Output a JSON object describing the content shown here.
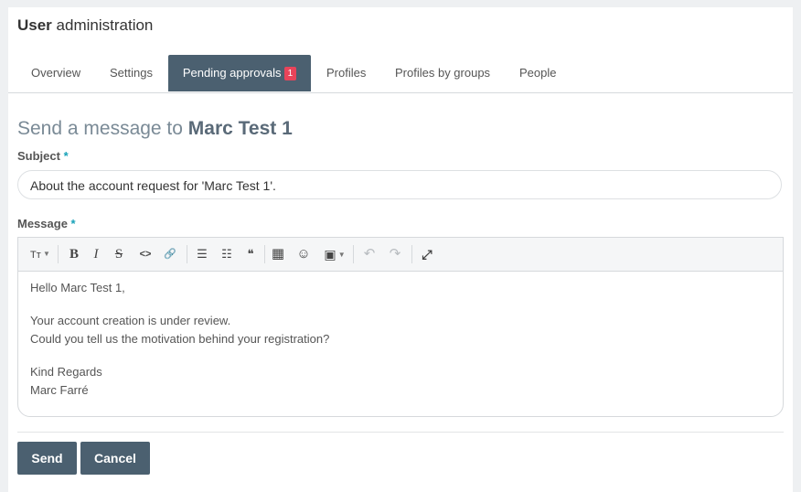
{
  "header": {
    "title_bold": "User",
    "title_rest": "administration"
  },
  "tabs": [
    {
      "label": "Overview",
      "active": false
    },
    {
      "label": "Settings",
      "active": false
    },
    {
      "label": "Pending approvals",
      "badge": "1",
      "active": true
    },
    {
      "label": "Profiles",
      "active": false
    },
    {
      "label": "Profiles by groups",
      "active": false
    },
    {
      "label": "People",
      "active": false
    }
  ],
  "form": {
    "heading_prefix": "Send a message to",
    "heading_name": "Marc Test 1",
    "subject_label": "Subject",
    "required_mark": "*",
    "subject_value": "About the account request for 'Marc Test 1'.",
    "message_label": "Message",
    "message_lines": {
      "greeting": "Hello Marc Test 1,",
      "line1": "Your account creation is under review.",
      "line2": "Could you tell us the motivation behind your registration?",
      "closing": "Kind Regards",
      "signature": "Marc Farré"
    }
  },
  "toolbar": {
    "text_size": "Tт",
    "bold": "B",
    "italic": "I",
    "strike": "S",
    "code": "<>",
    "link": "🔗",
    "bullet_list": "☰",
    "ordered_list": "☷",
    "quote": "❝",
    "table": "▦",
    "emoji": "☺",
    "image": "▣",
    "undo": "↶",
    "redo": "↷",
    "fullscreen": "⤢"
  },
  "actions": {
    "send": "Send",
    "cancel": "Cancel"
  },
  "colors": {
    "accent": "#4b6070",
    "badge": "#e8445a",
    "required": "#17a2b8"
  }
}
